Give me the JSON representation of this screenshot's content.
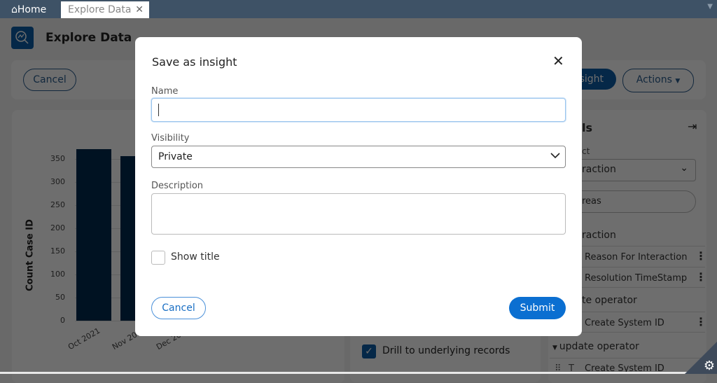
{
  "tabs": {
    "home": "Home",
    "explore": "Explore Data"
  },
  "header": {
    "title": "Explore Data"
  },
  "toolbar": {
    "cancel": "Cancel",
    "save_insight": "sight",
    "actions": "Actions"
  },
  "chart_data": {
    "type": "bar",
    "ylabel": "Count Case ID",
    "categories": [
      "Oct 2021",
      "Nov 202",
      "Dec 20"
    ],
    "values": [
      371,
      356,
      null
    ],
    "yticks": [
      0,
      50,
      100,
      150,
      200,
      250,
      300,
      350
    ],
    "ylim": [
      0,
      370
    ],
    "grid": true,
    "color": "#002b50"
  },
  "middle": {
    "drill_label": "Drill to underlying records",
    "drill_checked": true
  },
  "panel": {
    "title": "ls",
    "object_label": "ct",
    "object_value": "raction",
    "search_value": "reas",
    "groups": [
      {
        "label": "raction",
        "items": [
          "Reason For Interaction",
          "Resolution TimeStamp"
        ]
      },
      {
        "label": "te operator",
        "items": [
          "Create System ID"
        ]
      },
      {
        "label": "update operator",
        "items": [
          "Create System ID"
        ]
      }
    ],
    "type_glyph": "T"
  },
  "modal": {
    "title": "Save as insight",
    "name_label": "Name",
    "name_value": "",
    "visibility_label": "Visibility",
    "visibility_value": "Private",
    "description_label": "Description",
    "description_value": "",
    "show_title_label": "Show title",
    "show_title_checked": false,
    "cancel": "Cancel",
    "submit": "Submit",
    "accent": "#0b6fd1"
  }
}
